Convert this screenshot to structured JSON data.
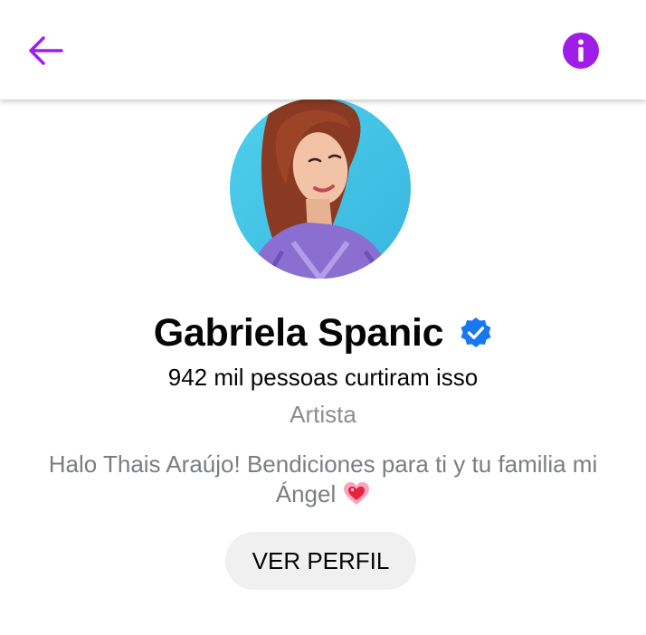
{
  "header": {
    "back_icon": "arrow-left-icon",
    "info_icon": "info-circle-icon",
    "accent_color": "#a01de8"
  },
  "profile": {
    "name": "Gabriela Spanic",
    "verified": true,
    "verified_icon": "verified-badge-icon",
    "verified_color": "#1877f2",
    "likes_text": "942 mil pessoas curtiram isso",
    "category": "Artista",
    "bio": "Halo Thais Araújo! Bendiciones para ti y tu familia mi Ángel",
    "bio_emoji_icon": "sparkling-heart-icon",
    "avatar_icon": "profile-photo"
  },
  "actions": {
    "view_profile_label": "VER PERFIL"
  }
}
